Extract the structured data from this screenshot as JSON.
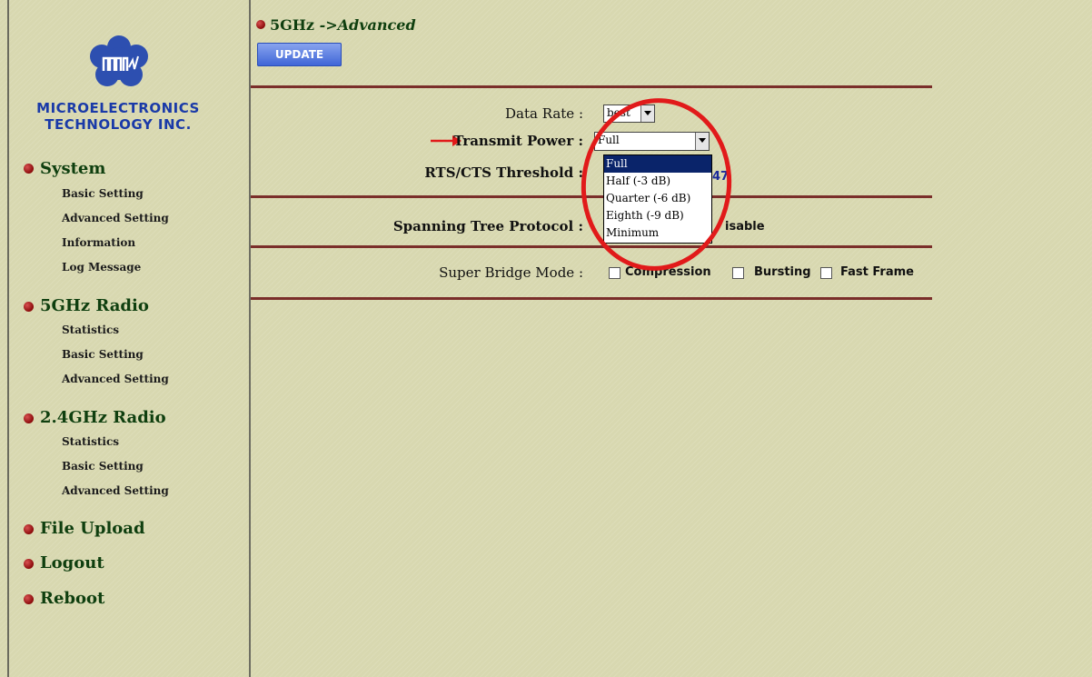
{
  "sidebar": {
    "company_line1": "MICROELECTRONICS",
    "company_line2": "TECHNOLOGY INC.",
    "sections": [
      {
        "label": "System",
        "items": [
          "Basic Setting",
          "Advanced Setting",
          "Information",
          "Log Message"
        ]
      },
      {
        "label": "5GHz Radio",
        "items": [
          "Statistics",
          "Basic Setting",
          "Advanced Setting"
        ]
      },
      {
        "label": "2.4GHz Radio",
        "items": [
          "Statistics",
          "Basic Setting",
          "Advanced Setting"
        ]
      },
      {
        "label": "File Upload",
        "items": []
      },
      {
        "label": "Logout",
        "items": []
      },
      {
        "label": "Reboot",
        "items": []
      }
    ]
  },
  "header": {
    "title_main": "5GHz",
    "title_sub": "->Advanced",
    "update_label": "UPDATE"
  },
  "form": {
    "data_rate_label": "Data Rate :",
    "data_rate_value": "best",
    "transmit_power_label": "Transmit Power :",
    "transmit_power_value": "Full",
    "transmit_power_options": [
      "Full",
      "Half (-3 dB)",
      "Quarter (-6 dB)",
      "Eighth (-9 dB)",
      "Minimum"
    ],
    "rts_label": "RTS/CTS Threshold :",
    "rts_value_visible": "47",
    "stp_label": "Spanning Tree Protocol :",
    "stp_value_visible": "isable",
    "sbm_label": "Super Bridge Mode :",
    "sbm_options": [
      "Compression",
      "Bursting",
      "Fast Frame"
    ]
  },
  "colors": {
    "background": "#d8d8b0",
    "nav_text": "#0f3f0f",
    "rule": "#7a2e2a",
    "annotation": "#e11a1a",
    "button": "#3c63d6"
  }
}
